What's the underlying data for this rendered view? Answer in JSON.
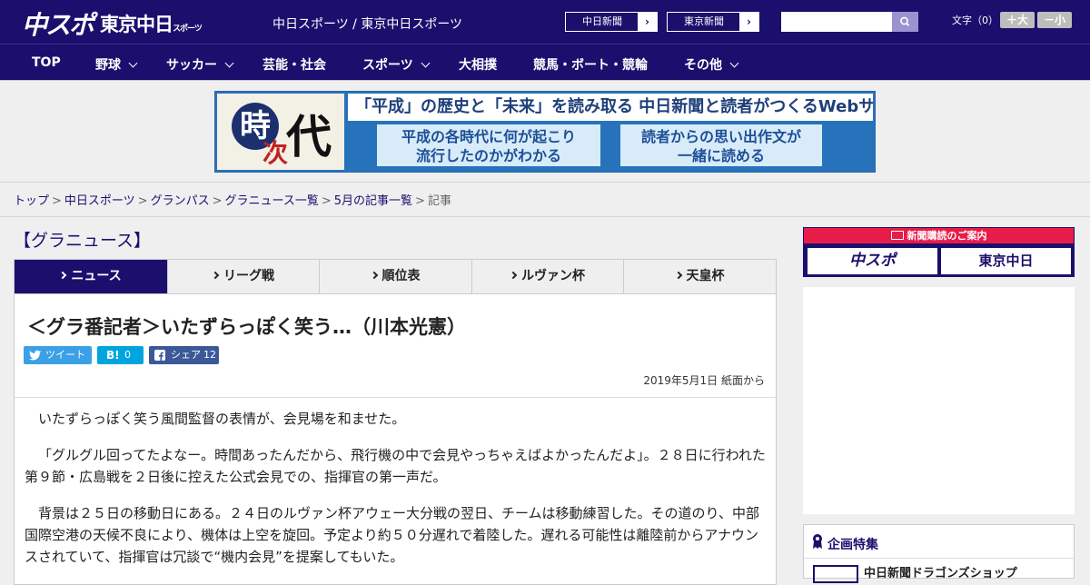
{
  "header": {
    "logo_chuspo": "中スポ",
    "logo_tokyo": "東京中日",
    "logo_tokyo_sub": "スポーツ",
    "site_title": "中日スポーツ / 東京中日スポーツ",
    "paper_buttons": [
      "中日新聞",
      "東京新聞"
    ],
    "font_label": "文字（0）",
    "font_larger": "＋大",
    "font_smaller": "－小"
  },
  "nav": {
    "items": [
      "TOP",
      "野球",
      "サッカー",
      "芸能・社会",
      "スポーツ",
      "大相撲",
      "競馬・ボート・競輪",
      "その他"
    ]
  },
  "banner": {
    "kanji_toki": "時",
    "kanji_ji": "次",
    "kanji_dai": "代",
    "headline": "「平成」の歴史と「未来」を読み取る 中日新聞と読者がつくるWebサイト",
    "box1_line1": "平成の各時代に何が起こり",
    "box1_line2": "流行したのかがわかる",
    "box2_line1": "読者からの思い出作文が",
    "box2_line2": "一緒に読める"
  },
  "breadcrumb": {
    "links": [
      "トップ",
      "中日スポーツ",
      "グランパス",
      "グラニュース一覧",
      "5月の記事一覧"
    ],
    "current": "記事",
    "separator": ">"
  },
  "main": {
    "section_title": "【グラニュース】",
    "tabs": [
      "ニュース",
      "リーグ戦",
      "順位表",
      "ルヴァン杯",
      "天皇杯"
    ],
    "article": {
      "title": "＜グラ番記者＞いたずらっぽく笑う…（川本光憲）",
      "share_tweet": "ツイート",
      "share_hatena_label": "B!",
      "share_hatena_count": "0",
      "share_fb_label": "シェア",
      "share_fb_count": "12",
      "date": "2019年5月1日 紙面から",
      "paragraphs": [
        "いたずらっぽく笑う風間監督の表情が、会見場を和ませた。",
        "「グルグル回ってたよなー。時間あったんだから、飛行機の中で会見やっちゃえばよかったんだよ」。２８日に行われた第９節・広島戦を２日後に控えた公式会見での、指揮官の第一声だ。",
        "背景は２５日の移動日にある。２４日のルヴァン杯アウェー大分戦の翌日、チームは移動練習した。その道のり、中部国際空港の天候不良により、機体は上空を旋回。予定より約５０分遅れで着陸した。遅れる可能性は離陸前からアナウンスされていて、指揮官は冗談で“機内会見”を提案してもいた。"
      ]
    }
  },
  "sidebar": {
    "subscribe_title": "新聞購読のご案内",
    "subscribe_logo1": "中スポ",
    "subscribe_logo2": "東京中日",
    "feature_title": "企画特集",
    "feature_item": "中日新聞ドラゴンズショップ"
  },
  "colors": {
    "brand": "#1b0f6e",
    "accent_red": "#e71c49"
  }
}
